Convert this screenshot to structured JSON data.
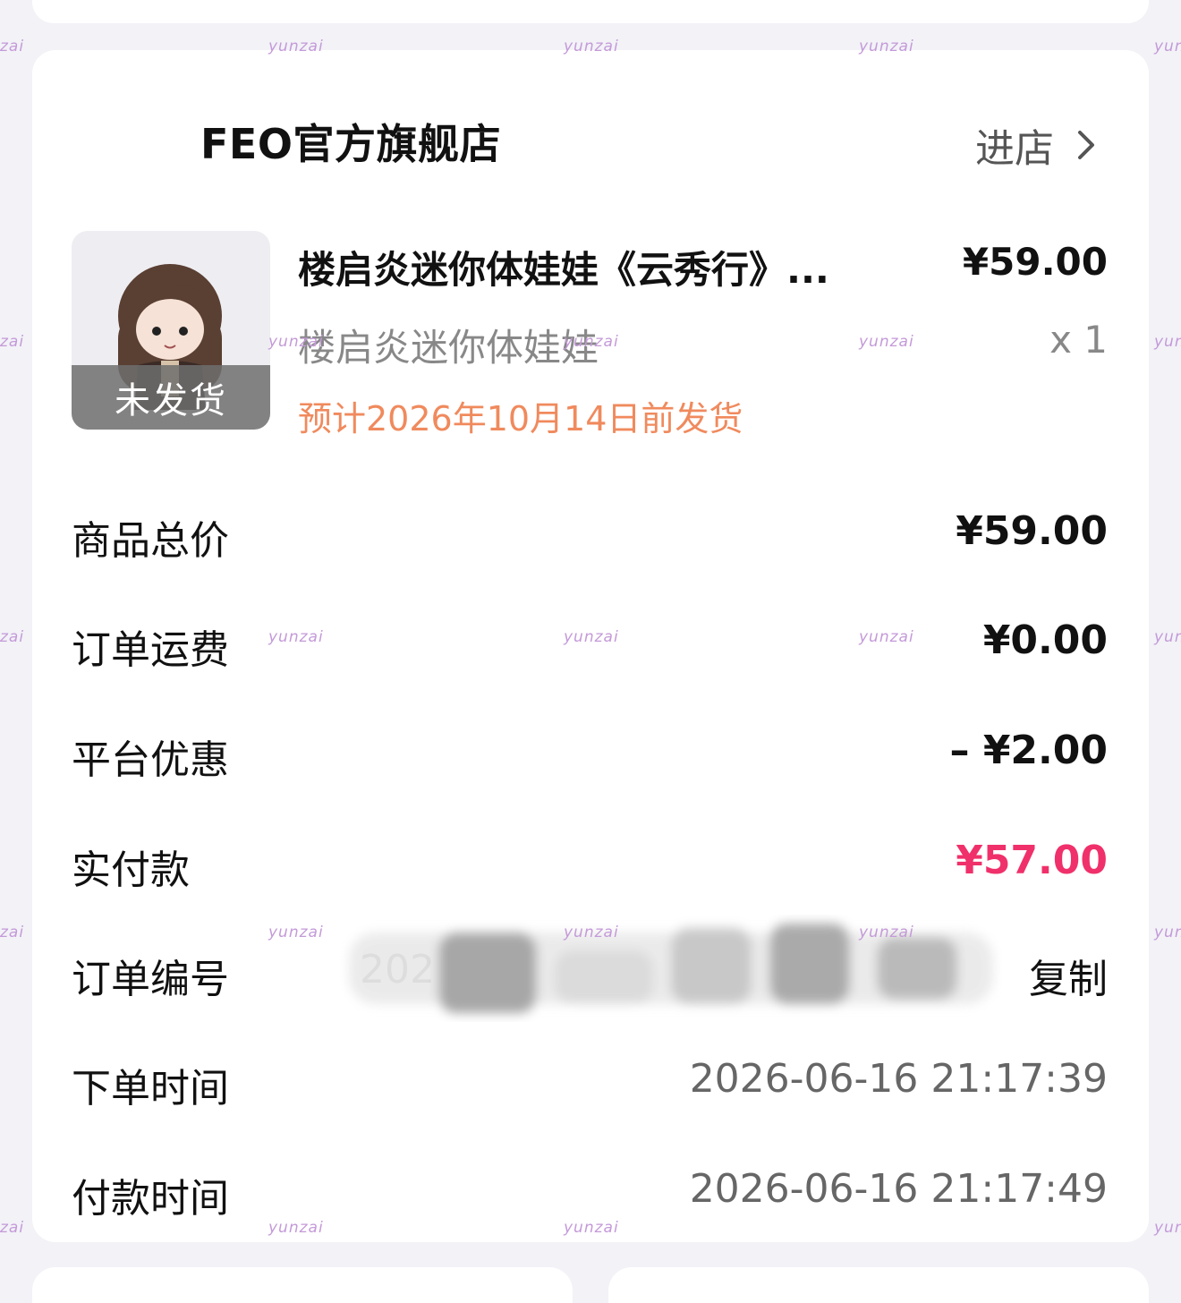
{
  "shop": {
    "name": "FEO官方旗舰店",
    "enter_label": "进店"
  },
  "product": {
    "title": "楼启炎迷你体娃娃《云秀行》...",
    "price": "¥59.00",
    "spec": "楼启炎迷你体娃娃",
    "qty": "x 1",
    "status": "未发货",
    "ship_note": "预计2026年10月14日前发货"
  },
  "summary": {
    "goods_total_label": "商品总价",
    "goods_total": "¥59.00",
    "shipping_label": "订单运费",
    "shipping": "¥0.00",
    "discount_label": "平台优惠",
    "discount": "– ¥2.00",
    "paid_label": "实付款",
    "paid": "¥57.00",
    "order_no_label": "订单编号",
    "order_no_partial": "202",
    "copy_label": "复制",
    "order_time_label": "下单时间",
    "order_time": "2026-06-16 21:17:39",
    "pay_time_label": "付款时间",
    "pay_time": "2026-06-16 21:17:49"
  },
  "watermark": "yunzai",
  "watermark_edge": "zai",
  "watermark_edge_right": "yun",
  "colors": {
    "accent_price": "#f0306a",
    "ship_note": "#f08a5d",
    "watermark": "#c49ad8"
  }
}
